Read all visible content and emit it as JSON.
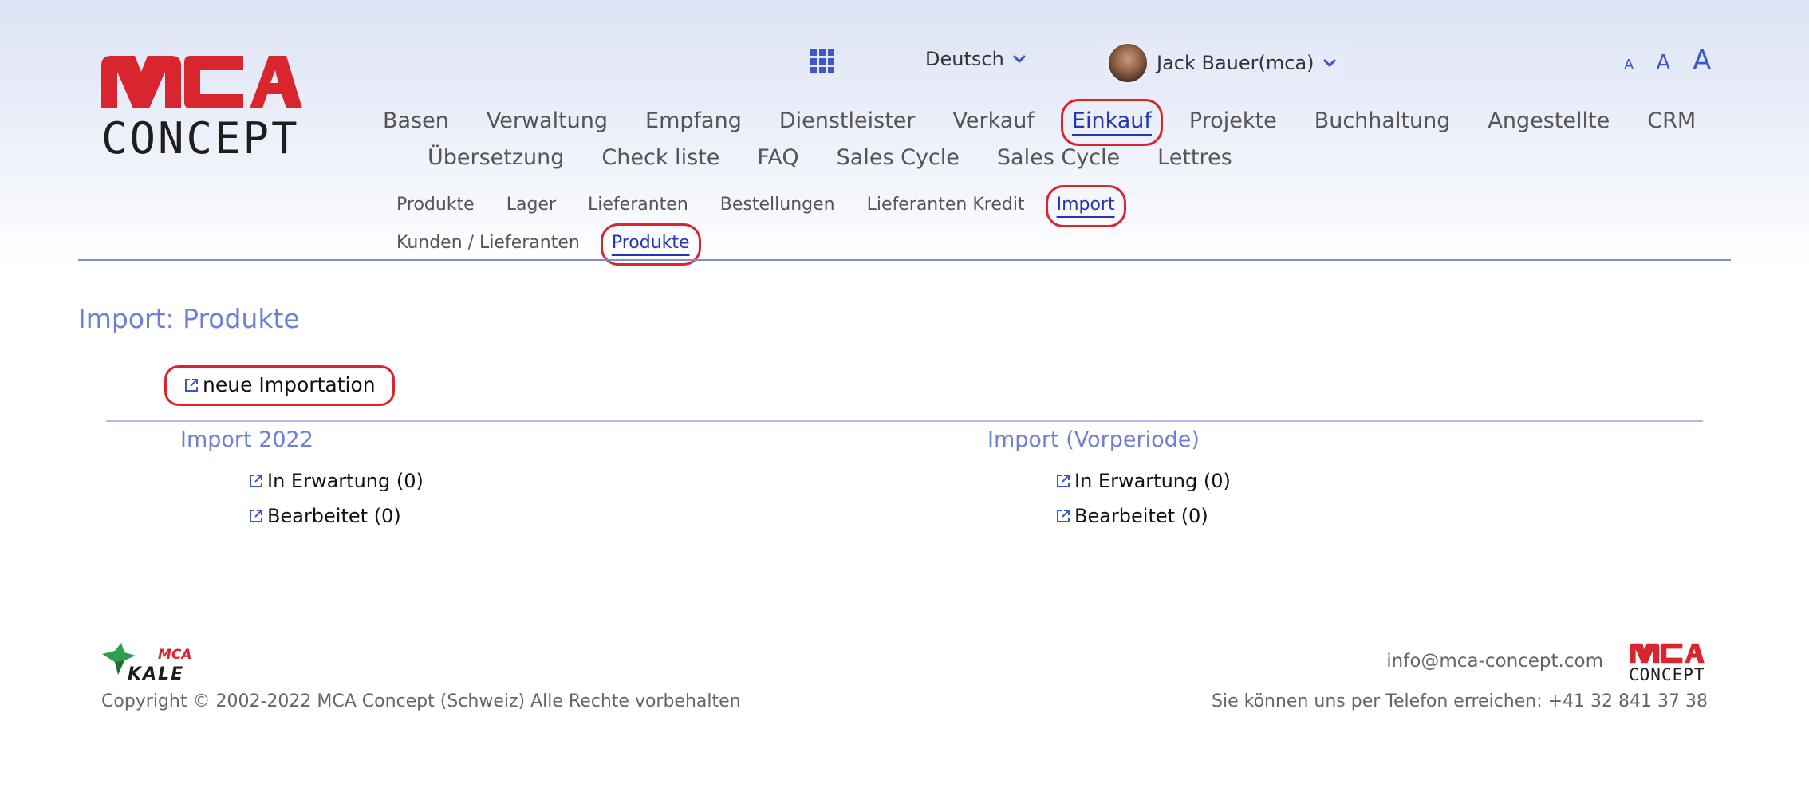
{
  "header": {
    "logo_text_top": "MCA",
    "logo_text_bottom": "CONCEPT",
    "apps_icon": "grid-icon",
    "language": "Deutsch",
    "user": "Jack Bauer(mca)",
    "font_sizes": [
      "A",
      "A",
      "A"
    ]
  },
  "main_nav": {
    "row1": [
      "Basen",
      "Verwaltung",
      "Empfang",
      "Dienstleister",
      "Verkauf",
      "Einkauf",
      "Projekte",
      "Buchhaltung",
      "Angestellte",
      "CRM"
    ],
    "row2": [
      "Übersetzung",
      "Check liste",
      "FAQ",
      "Sales Cycle",
      "Sales Cycle",
      "Lettres"
    ],
    "active": "Einkauf"
  },
  "sub_nav": {
    "row1": [
      "Produkte",
      "Lager",
      "Lieferanten",
      "Bestellungen",
      "Lieferanten Kredit",
      "Import"
    ],
    "row2": [
      "Kunden / Lieferanten",
      "Produkte"
    ],
    "active_row1": "Import",
    "active_row2": "Produkte"
  },
  "page": {
    "title": "Import: Produkte",
    "new_import": "neue Importation",
    "left": {
      "heading": "Import 2022",
      "links": [
        "In Erwartung (0)",
        "Bearbeitet (0)"
      ]
    },
    "right": {
      "heading": "Import (Vorperiode)",
      "links": [
        "In Erwartung (0)",
        "Bearbeitet (0)"
      ]
    }
  },
  "footer": {
    "kale_logo_text_top": "MCA",
    "kale_logo_text_bottom": "KALE",
    "copyright": "Copyright © 2002-2022 MCA Concept (Schweiz) Alle Rechte vorbehalten",
    "email": "info@mca-concept.com",
    "phone": "Sie können uns per Telefon erreichen: +41 32 841 37 38",
    "logo_text_top": "MCA",
    "logo_text_bottom": "CONCEPT"
  },
  "colors": {
    "brand_red": "#d9252d",
    "accent_blue": "#2435b8",
    "heading_blue": "#6f7fd8"
  }
}
